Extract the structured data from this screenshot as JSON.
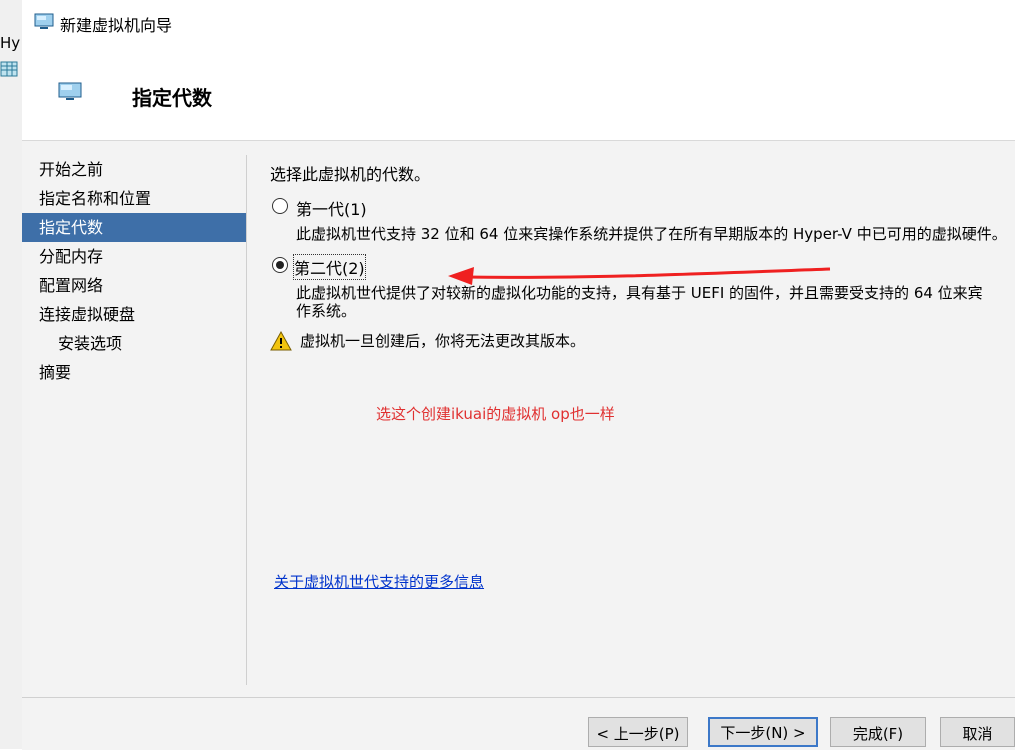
{
  "background": {
    "left_text": "Hy"
  },
  "window": {
    "title": "新建虚拟机向导"
  },
  "header": {
    "title": "指定代数"
  },
  "nav": {
    "items": [
      {
        "label": "开始之前",
        "active": false,
        "sub": false
      },
      {
        "label": "指定名称和位置",
        "active": false,
        "sub": false
      },
      {
        "label": "指定代数",
        "active": true,
        "sub": false
      },
      {
        "label": "分配内存",
        "active": false,
        "sub": false
      },
      {
        "label": "配置网络",
        "active": false,
        "sub": false
      },
      {
        "label": "连接虚拟硬盘",
        "active": false,
        "sub": false
      },
      {
        "label": "安装选项",
        "active": false,
        "sub": true
      },
      {
        "label": "摘要",
        "active": false,
        "sub": false
      }
    ]
  },
  "content": {
    "prompt": "选择此虚拟机的代数。",
    "gen1": {
      "label": "第一代(1)",
      "selected": false,
      "description": "此虚拟机世代支持 32 位和 64 位来宾操作系统并提供了在所有早期版本的 Hyper-V 中已可用的虚拟硬件。"
    },
    "gen2": {
      "label": "第二代(2)",
      "selected": true,
      "description_line1": "此虚拟机世代提供了对较新的虚拟化功能的支持，具有基于 UEFI 的固件，并且需要受支持的 64 位来宾",
      "description_line2": "作系统。"
    },
    "warning": "虚拟机一旦创建后，你将无法更改其版本。",
    "annotation": "选这个创建ikuai的虚拟机  op也一样",
    "link": "关于虚拟机世代支持的更多信息"
  },
  "buttons": {
    "prev": "< 上一步(P)",
    "next": "下一步(N) >",
    "finish": "完成(F)",
    "cancel": "取消"
  },
  "colors": {
    "nav_active": "#3e6fa8",
    "annotation": "#e03030",
    "link": "#0033cc"
  }
}
